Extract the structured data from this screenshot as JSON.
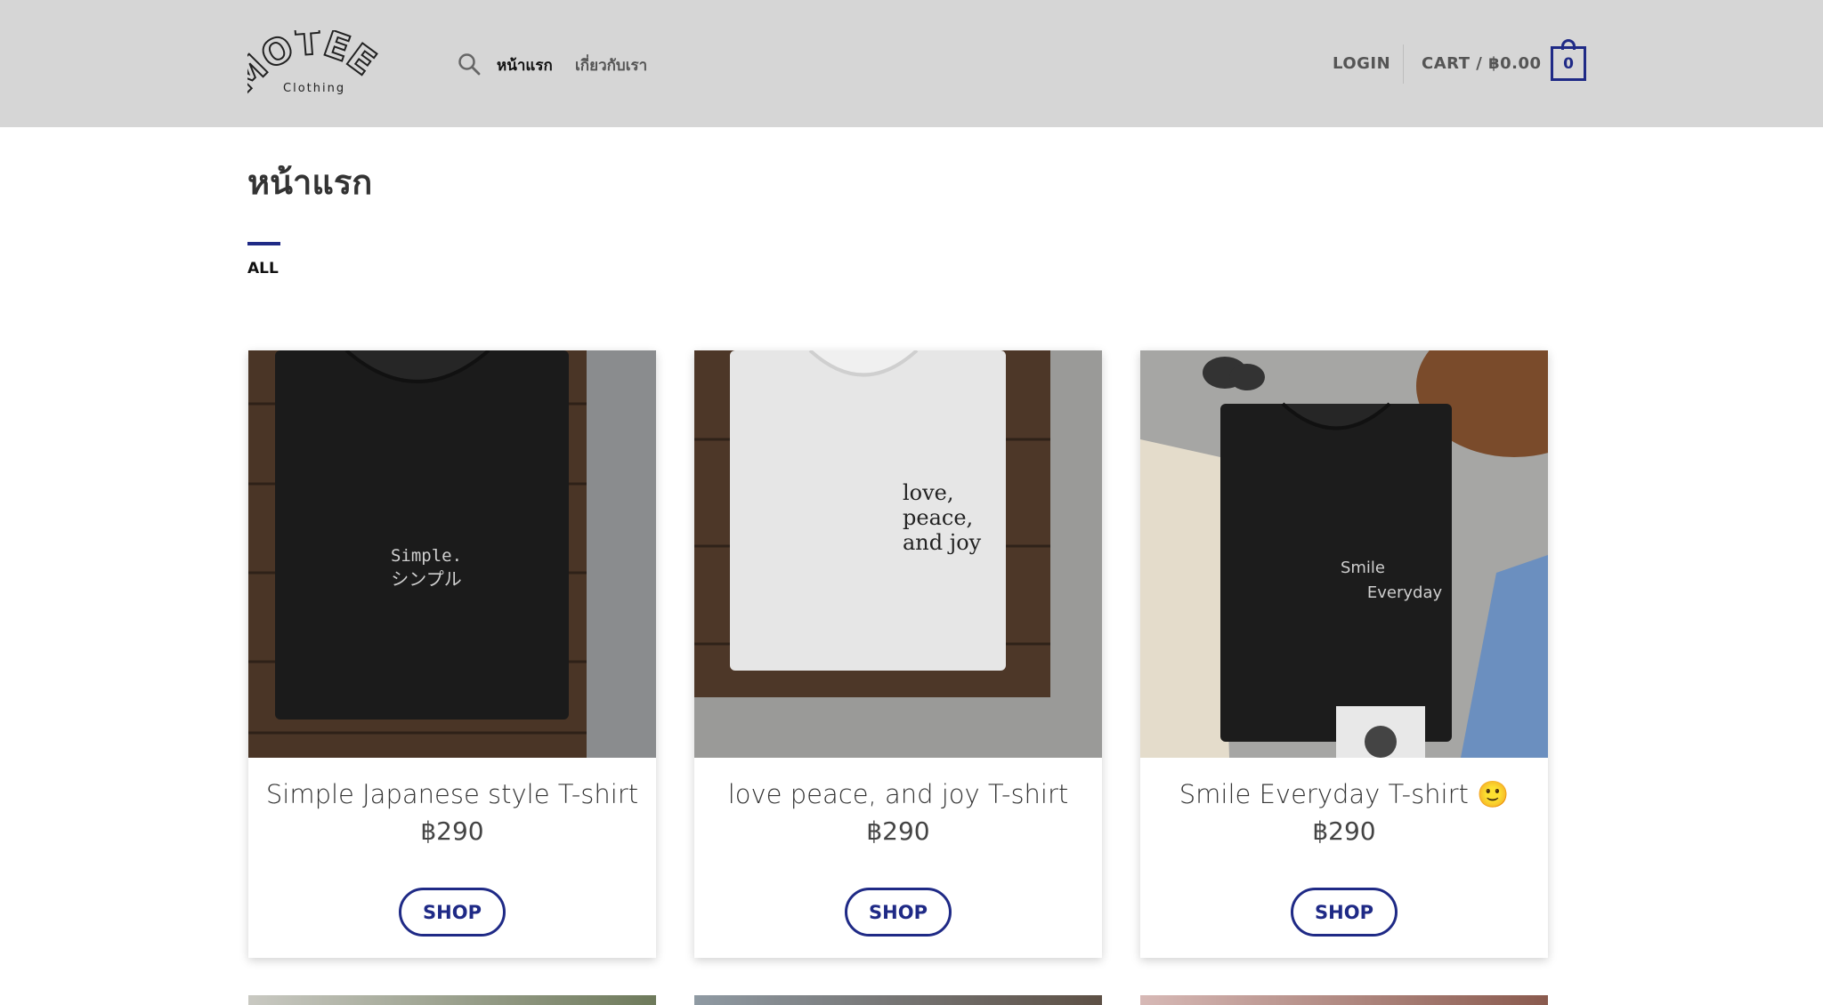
{
  "header": {
    "logo_text": "MOTEES",
    "logo_sub": "Clothing",
    "nav": {
      "home": "หน้าแรก",
      "about": "เกี่ยวกับเรา"
    },
    "login": "LOGIN",
    "cart_label": "CART / ฿0.00",
    "cart_count": "0"
  },
  "page": {
    "title": "หน้าแรก",
    "filter_all": "ALL"
  },
  "products": [
    {
      "name": "Simple Japanese style T-shirt",
      "price": "฿290",
      "button": "SHOP",
      "shirt_print": "Simple.\nシンプル"
    },
    {
      "name": "love peace, and joy T-shirt",
      "price": "฿290",
      "button": "SHOP",
      "shirt_print": "love,\npeace,\nand joy"
    },
    {
      "name": "Smile Everyday T-shirt 🙂",
      "price": "฿290",
      "button": "SHOP",
      "shirt_print": "Smile\nEveryday"
    }
  ],
  "colors": {
    "accent": "#1f2a86",
    "header_bg": "#d6d6d6"
  }
}
